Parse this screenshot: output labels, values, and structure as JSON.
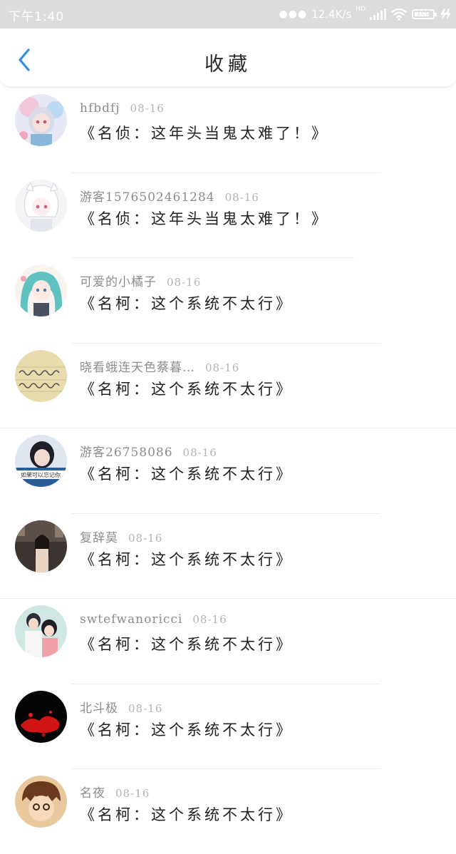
{
  "status_bar": {
    "time": "下午1:40",
    "network_speed": "12.4K/s",
    "network_badge": "HD",
    "battery": "100"
  },
  "header": {
    "back_icon": "chevron-left-icon",
    "title": "收藏",
    "accent_color": "#2f8ee6"
  },
  "favorites": [
    {
      "user": "hfbdfj",
      "date": "08-16",
      "title": "《名侦：这年头当鬼太难了！》",
      "avatar": "anime-girl-avatar"
    },
    {
      "user": "游客1576502461284",
      "date": "08-16",
      "title": "《名侦：这年头当鬼太难了！》",
      "avatar": "white-hair-boy-avatar"
    },
    {
      "user": "可爱的小橘子",
      "date": "08-16",
      "title": "《名柯：这个系统不太行》",
      "avatar": "teal-hair-girl-avatar"
    },
    {
      "user": "晓看蛾连天色蔡暮…",
      "date": "08-16",
      "title": "《名柯：这个系统不太行》",
      "avatar": "handwriting-note-avatar"
    },
    {
      "user": "游客26758086",
      "date": "08-16",
      "title": "《名柯：这个系统不太行》",
      "avatar": "girl-photo-avatar"
    },
    {
      "user": "复辞莫",
      "date": "08-16",
      "title": "《名柯：这个系统不太行》",
      "avatar": "night-street-avatar"
    },
    {
      "user": "swtefwanoricci",
      "date": "08-16",
      "title": "《名柯：这个系统不太行》",
      "avatar": "couple-illustration-avatar"
    },
    {
      "user": "北斗极",
      "date": "08-16",
      "title": "《名柯：这个系统不太行》",
      "avatar": "red-splash-avatar"
    },
    {
      "user": "名夜",
      "date": "08-16",
      "title": "《名柯：这个系统不太行》",
      "avatar": "cartoon-boy-avatar"
    }
  ]
}
